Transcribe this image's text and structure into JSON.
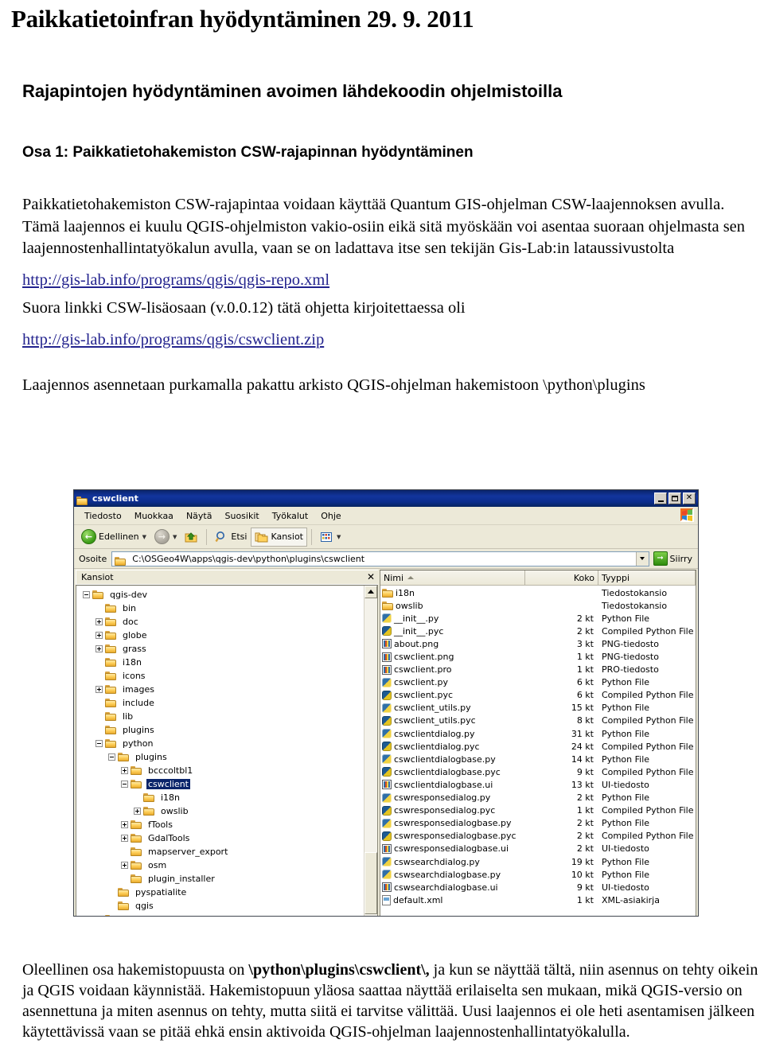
{
  "document": {
    "title": "Paikkatietoinfran hyödyntäminen 29. 9. 2011",
    "heading1": "Rajapintojen hyödyntäminen avoimen lähdekoodin ohjelmistoilla",
    "heading2": "Osa 1: Paikkatietohakemiston CSW-rajapinnan hyödyntäminen",
    "paragraph1": "Paikkatietohakemiston  CSW-rajapintaa voidaan käyttää Quantum GIS-ohjelman CSW-laajennoksen avulla.  Tämä laajennos ei kuulu QGIS-ohjelmiston vakio-osiin eikä sitä myöskään voi asentaa suoraan ohjelmasta sen laajennostenhallintatyökalun avulla, vaan se on ladattava itse sen tekijän Gis-Lab:in lataussivustolta",
    "link1": "http://gis-lab.info/programs/qgis/qgis-repo.xml",
    "paragraph2": "Suora linkki CSW-lisäosaan (v.0.0.12) tätä ohjetta kirjoitettaessa oli",
    "link2": "http://gis-lab.info/programs/qgis/cswclient.zip",
    "caption": "Laajennos asennetaan purkamalla pakattu arkisto QGIS-ohjelman hakemistoon \\python\\plugins",
    "bottom_para_pre": "Oleellinen osa hakemistopuusta on ",
    "bottom_para_bold": "\\python\\plugins\\cswclient\\,",
    "bottom_para_post": " ja kun se näyttää tältä, niin asennus on tehty oikein ja QGIS voidaan käynnistää.  Hakemistopuun yläosa saattaa näyttää erilaiselta sen mukaan, mikä QGIS-versio on asennettuna ja miten asennus on tehty, mutta siitä ei tarvitse välittää. Uusi laajennos ei ole heti asentamisen jälkeen käytettävissä vaan se pitää ehkä ensin aktivoida QGIS-ohjelman laajennostenhallintatyökalulla.",
    "link_color": "#23238e"
  },
  "explorer": {
    "window_title": "cswclient",
    "title_icon": "folder-icon",
    "window_buttons": {
      "minimize": "minimize-icon",
      "maximize": "maximize-icon",
      "close": "close-icon"
    },
    "menu": [
      {
        "label": "Tiedosto",
        "accel": "T"
      },
      {
        "label": "Muokkaa",
        "accel": "M"
      },
      {
        "label": "Näytä",
        "accel": "N"
      },
      {
        "label": "Suosikit",
        "accel": "S"
      },
      {
        "label": "Työkalut",
        "accel": "T"
      },
      {
        "label": "Ohje",
        "accel": "O"
      }
    ],
    "toolbar": {
      "back_label": "Edellinen",
      "back_icon": "back-arrow-icon",
      "forward_icon": "forward-arrow-icon",
      "up_icon": "up-folder-icon",
      "search_label": "Etsi",
      "search_icon": "magnifier-icon",
      "folders_label": "Kansiot",
      "folders_icon": "folders-icon",
      "views_icon": "views-icon"
    },
    "address": {
      "label": "Osoite",
      "icon": "folder-icon",
      "value": "C:\\OSGeo4W\\apps\\qgis-dev\\python\\plugins\\cswclient",
      "go_label": "Siirry",
      "go_icon": "go-arrow-icon"
    },
    "folders_pane": {
      "header": "Kansiot",
      "close_icon": "close-icon",
      "tree": [
        {
          "label": "qgis-dev",
          "indent": 0,
          "expander": "minus",
          "selected": false
        },
        {
          "label": "bin",
          "indent": 1,
          "expander": "none",
          "selected": false
        },
        {
          "label": "doc",
          "indent": 1,
          "expander": "plus",
          "selected": false
        },
        {
          "label": "globe",
          "indent": 1,
          "expander": "plus",
          "selected": false
        },
        {
          "label": "grass",
          "indent": 1,
          "expander": "plus",
          "selected": false
        },
        {
          "label": "i18n",
          "indent": 1,
          "expander": "none",
          "selected": false
        },
        {
          "label": "icons",
          "indent": 1,
          "expander": "none",
          "selected": false
        },
        {
          "label": "images",
          "indent": 1,
          "expander": "plus",
          "selected": false
        },
        {
          "label": "include",
          "indent": 1,
          "expander": "none",
          "selected": false
        },
        {
          "label": "lib",
          "indent": 1,
          "expander": "none",
          "selected": false
        },
        {
          "label": "plugins",
          "indent": 1,
          "expander": "none",
          "selected": false
        },
        {
          "label": "python",
          "indent": 1,
          "expander": "minus",
          "selected": false
        },
        {
          "label": "plugins",
          "indent": 2,
          "expander": "minus",
          "selected": false
        },
        {
          "label": "bcccoltbl1",
          "indent": 3,
          "expander": "plus",
          "selected": false
        },
        {
          "label": "cswclient",
          "indent": 3,
          "expander": "minus",
          "selected": true
        },
        {
          "label": "i18n",
          "indent": 4,
          "expander": "none",
          "selected": false
        },
        {
          "label": "owslib",
          "indent": 4,
          "expander": "plus",
          "selected": false
        },
        {
          "label": "fTools",
          "indent": 3,
          "expander": "plus",
          "selected": false
        },
        {
          "label": "GdalTools",
          "indent": 3,
          "expander": "plus",
          "selected": false
        },
        {
          "label": "mapserver_export",
          "indent": 3,
          "expander": "none",
          "selected": false
        },
        {
          "label": "osm",
          "indent": 3,
          "expander": "plus",
          "selected": false
        },
        {
          "label": "plugin_installer",
          "indent": 3,
          "expander": "none",
          "selected": false
        },
        {
          "label": "pyspatialite",
          "indent": 2,
          "expander": "none",
          "selected": false
        },
        {
          "label": "qgis",
          "indent": 2,
          "expander": "none",
          "selected": false
        },
        {
          "label": "resources",
          "indent": 1,
          "expander": "plus",
          "selected": false
        }
      ]
    },
    "file_list": {
      "columns": {
        "name": "Nimi",
        "size": "Koko",
        "type": "Tyyppi",
        "sort": "asc"
      },
      "rows": [
        {
          "name": "i18n",
          "size": "",
          "type": "Tiedostokansio",
          "icon": "folder"
        },
        {
          "name": "owslib",
          "size": "",
          "type": "Tiedostokansio",
          "icon": "folder"
        },
        {
          "name": "__init__.py",
          "size": "2 kt",
          "type": "Python File",
          "icon": "py"
        },
        {
          "name": "__init__.pyc",
          "size": "2 kt",
          "type": "Compiled Python File",
          "icon": "pyc"
        },
        {
          "name": "about.png",
          "size": "3 kt",
          "type": "PNG-tiedosto",
          "icon": "img"
        },
        {
          "name": "cswclient.png",
          "size": "1 kt",
          "type": "PNG-tiedosto",
          "icon": "img"
        },
        {
          "name": "cswclient.pro",
          "size": "1 kt",
          "type": "PRO-tiedosto",
          "icon": "img"
        },
        {
          "name": "cswclient.py",
          "size": "6 kt",
          "type": "Python File",
          "icon": "py"
        },
        {
          "name": "cswclient.pyc",
          "size": "6 kt",
          "type": "Compiled Python File",
          "icon": "pyc"
        },
        {
          "name": "cswclient_utils.py",
          "size": "15 kt",
          "type": "Python File",
          "icon": "py"
        },
        {
          "name": "cswclient_utils.pyc",
          "size": "8 kt",
          "type": "Compiled Python File",
          "icon": "pyc"
        },
        {
          "name": "cswclientdialog.py",
          "size": "31 kt",
          "type": "Python File",
          "icon": "py"
        },
        {
          "name": "cswclientdialog.pyc",
          "size": "24 kt",
          "type": "Compiled Python File",
          "icon": "pyc"
        },
        {
          "name": "cswclientdialogbase.py",
          "size": "14 kt",
          "type": "Python File",
          "icon": "py"
        },
        {
          "name": "cswclientdialogbase.pyc",
          "size": "9 kt",
          "type": "Compiled Python File",
          "icon": "pyc"
        },
        {
          "name": "cswclientdialogbase.ui",
          "size": "13 kt",
          "type": "UI-tiedosto",
          "icon": "img"
        },
        {
          "name": "cswresponsedialog.py",
          "size": "2 kt",
          "type": "Python File",
          "icon": "py"
        },
        {
          "name": "cswresponsedialog.pyc",
          "size": "1 kt",
          "type": "Compiled Python File",
          "icon": "pyc"
        },
        {
          "name": "cswresponsedialogbase.py",
          "size": "2 kt",
          "type": "Python File",
          "icon": "py"
        },
        {
          "name": "cswresponsedialogbase.pyc",
          "size": "2 kt",
          "type": "Compiled Python File",
          "icon": "pyc"
        },
        {
          "name": "cswresponsedialogbase.ui",
          "size": "2 kt",
          "type": "UI-tiedosto",
          "icon": "img"
        },
        {
          "name": "cswsearchdialog.py",
          "size": "19 kt",
          "type": "Python File",
          "icon": "py"
        },
        {
          "name": "cswsearchdialogbase.py",
          "size": "10 kt",
          "type": "Python File",
          "icon": "py"
        },
        {
          "name": "cswsearchdialogbase.ui",
          "size": "9 kt",
          "type": "UI-tiedosto",
          "icon": "img"
        },
        {
          "name": "default.xml",
          "size": "1 kt",
          "type": "XML-asiakirja",
          "icon": "xml"
        }
      ]
    }
  }
}
